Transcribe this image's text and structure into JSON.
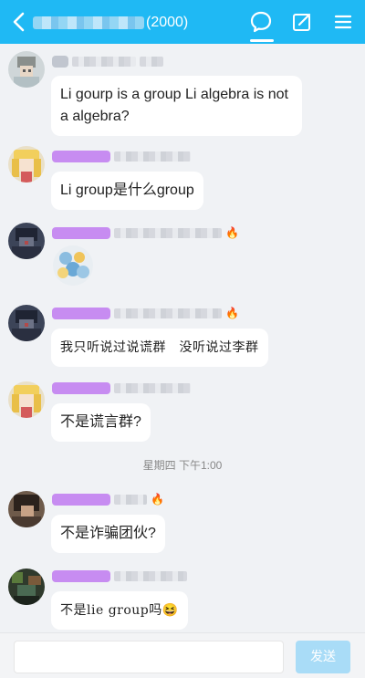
{
  "header": {
    "group_member_count": "(2000)",
    "icons": {
      "back": "chevron-left-icon",
      "chat": "chat-bubble-icon",
      "edit": "edit-icon",
      "menu": "hamburger-menu-icon"
    }
  },
  "colors": {
    "header": "#1fb9f4",
    "background": "#f0f2f5",
    "bubble": "#ffffff",
    "send_button": "#a9dcf7",
    "badge": "#c07af0",
    "fire": "#ff6a1a"
  },
  "messages": [
    {
      "text": "Li gourp is a group Li algebra is not a algebra?",
      "fire": ""
    },
    {
      "text": "Li group是什么group",
      "fire": ""
    },
    {
      "text": "",
      "sticker": "sticker-icon",
      "fire": "🔥"
    },
    {
      "text": "我只听说过说谎群　没听说过李群",
      "fire": "🔥"
    },
    {
      "text": "不是谎言群?",
      "fire": ""
    },
    {
      "text": "不是诈骗团伙?",
      "fire": "🔥"
    },
    {
      "text": "不是lie group吗",
      "emoji": "😆",
      "fire": ""
    }
  ],
  "timestamp": "星期四 下午1:00",
  "input": {
    "value": "",
    "placeholder": ""
  },
  "send_label": "发送"
}
